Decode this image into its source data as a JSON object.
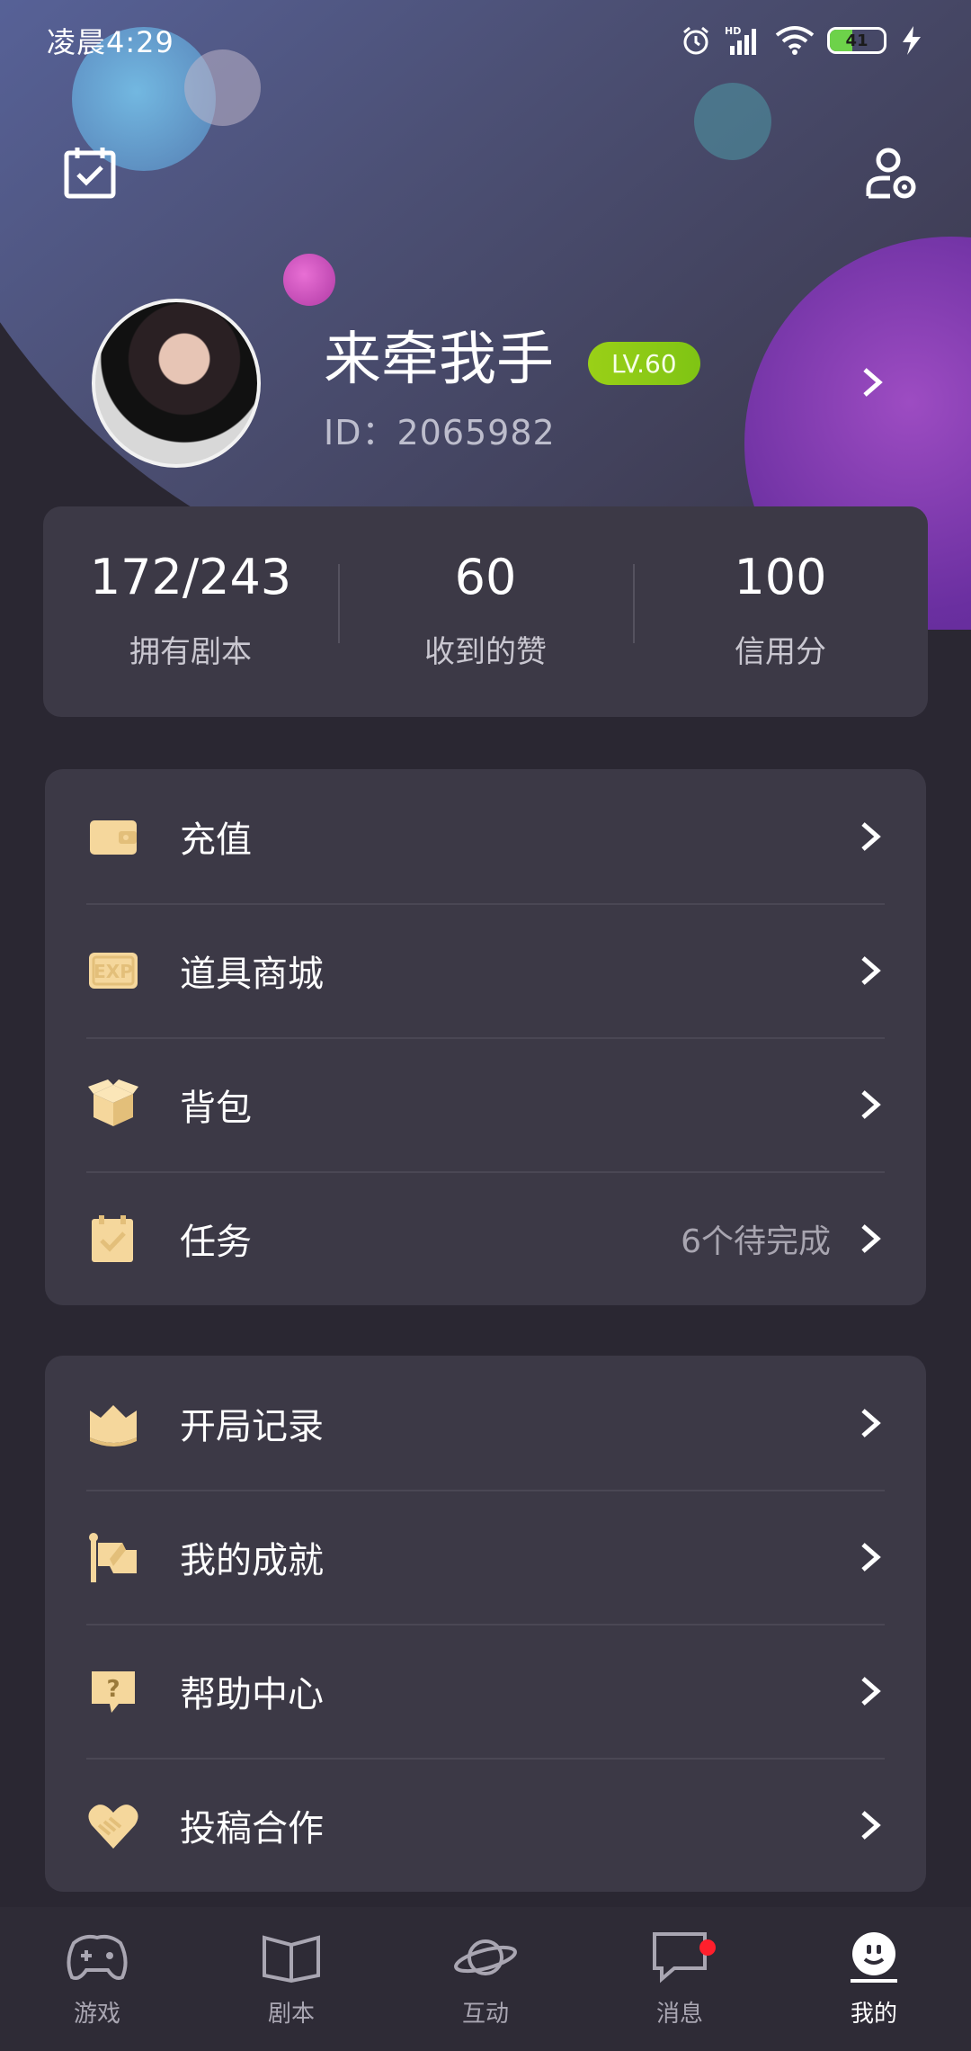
{
  "status_bar": {
    "time": "凌晨4:29",
    "battery_level": "41",
    "battery_fraction": 0.41
  },
  "profile": {
    "username": "来牵我手",
    "level": "LV.60",
    "user_id": "ID：2065982"
  },
  "stats": [
    {
      "value": "172/243",
      "label": "拥有剧本"
    },
    {
      "value": "60",
      "label": "收到的赞"
    },
    {
      "value": "100",
      "label": "信用分"
    }
  ],
  "menu_group_1": [
    {
      "label": "充值",
      "icon": "wallet-icon"
    },
    {
      "label": "道具商城",
      "icon": "exp-store-icon"
    },
    {
      "label": "背包",
      "icon": "box-icon"
    },
    {
      "label": "任务",
      "icon": "task-icon",
      "hint": "6个待完成"
    }
  ],
  "menu_group_2": [
    {
      "label": "开局记录",
      "icon": "book-icon"
    },
    {
      "label": "我的成就",
      "icon": "flag-icon"
    },
    {
      "label": "帮助中心",
      "icon": "help-icon"
    },
    {
      "label": "投稿合作",
      "icon": "handshake-icon"
    }
  ],
  "bottom_nav": [
    {
      "label": "游戏",
      "icon": "gamepad-icon"
    },
    {
      "label": "剧本",
      "icon": "open-book-icon"
    },
    {
      "label": "互动",
      "icon": "planet-icon"
    },
    {
      "label": "消息",
      "icon": "chat-icon",
      "has_badge": true
    },
    {
      "label": "我的",
      "icon": "smiley-icon",
      "active": true
    }
  ],
  "colors": {
    "accent_gold": "#f5d79c",
    "level_green": "#8fcb16",
    "card_bg": "#3c3946",
    "page_bg": "#2a2732",
    "badge_red": "#ff1f2c"
  }
}
